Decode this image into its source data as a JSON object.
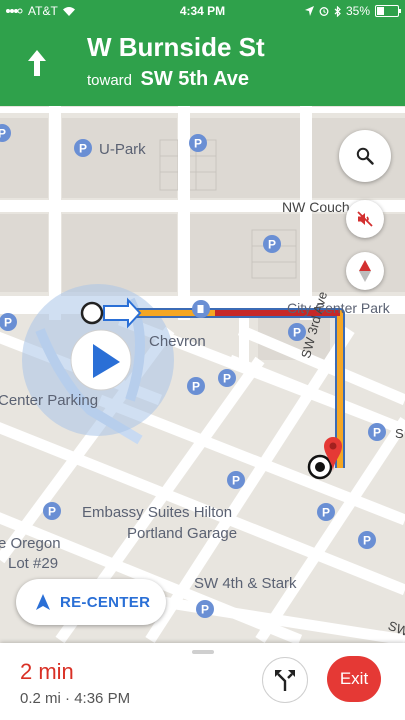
{
  "status_bar": {
    "carrier": "AT&T",
    "time": "4:34 PM",
    "battery": "35%",
    "battery_level": 0.35,
    "icons": [
      "signal-icon",
      "wifi-icon",
      "location-icon",
      "alarm-icon",
      "bluetooth-icon",
      "battery-icon"
    ]
  },
  "navigation": {
    "street": "W Burnside St",
    "toward_prefix": "toward",
    "destination": "SW 5th Ave",
    "turn_icon": "arrow-up-icon",
    "header_color": "#2fa14b"
  },
  "map": {
    "labels": {
      "u_park": "U-Park",
      "nw_couch": "NW Couch St",
      "city_center_park": "City Center Park",
      "chevron": "Chevron",
      "center_parking": "Center Parking",
      "sw_3rd_ave": "SW 3rd Ave",
      "embassy_line1": "Embassy Suites Hilton",
      "embassy_line2": "Portland Garage",
      "oregon_line1": "e Oregon",
      "oregon_line2": "Lot #29",
      "sw_4th_stark": "SW 4th & Stark",
      "edge_s": "S",
      "edge_sw": "SW"
    },
    "route_colors": {
      "traffic_heavy": "#c62828",
      "traffic_slow": "#f5a623",
      "route_border": "#3b6bb5"
    },
    "controls": {
      "search_icon": "search-icon",
      "mute_icon": "volume-off-icon",
      "compass_icon": "compass-icon"
    }
  },
  "recenter": {
    "label": "RE-CENTER",
    "icon": "navigation-arrow-icon"
  },
  "bottom": {
    "eta_time": "2 min",
    "distance": "0.2 mi",
    "separator": "·",
    "arrival": "4:36 PM",
    "routes_icon": "alternate-routes-icon",
    "exit_label": "Exit",
    "exit_color": "#e53935"
  }
}
